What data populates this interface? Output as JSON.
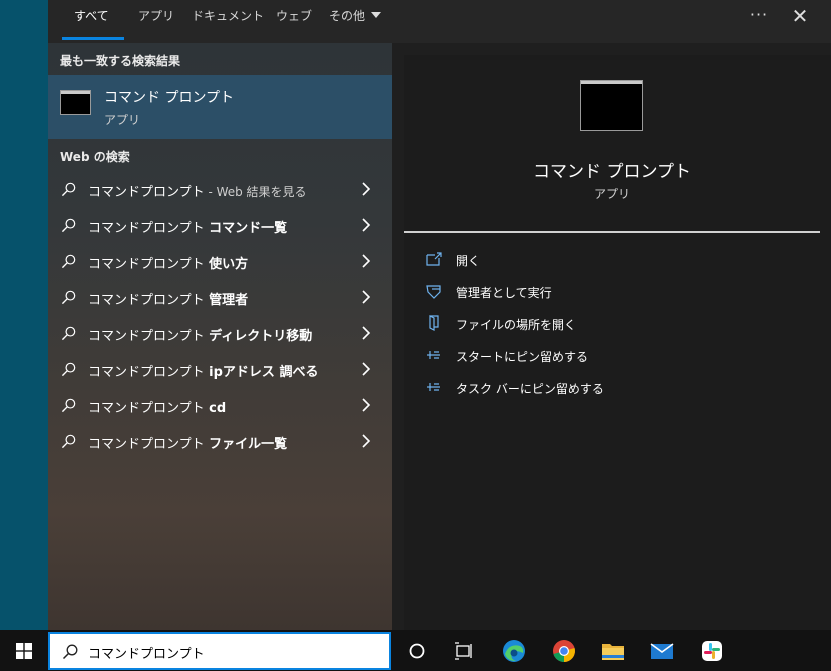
{
  "tabs": [
    {
      "label": "すべて",
      "active": true
    },
    {
      "label": "アプリ"
    },
    {
      "label": "ドキュメント"
    },
    {
      "label": "ウェブ"
    },
    {
      "label": "その他"
    }
  ],
  "window_controls": {
    "more": "···",
    "close": "✕"
  },
  "best_match": {
    "heading": "最も一致する検索結果",
    "title": "コマンド プロンプト",
    "subtitle": "アプリ"
  },
  "web_search": {
    "heading": "Web の検索",
    "items": [
      {
        "base": "コマンドプロンプト",
        "suffix": " - Web 結果を見る",
        "suffix_style": "muted"
      },
      {
        "base": "コマンドプロンプト",
        "suffix": " コマンド一覧",
        "suffix_style": "bold"
      },
      {
        "base": "コマンドプロンプト",
        "suffix": " 使い方",
        "suffix_style": "bold"
      },
      {
        "base": "コマンドプロンプト",
        "suffix": " 管理者",
        "suffix_style": "bold"
      },
      {
        "base": "コマンドプロンプト",
        "suffix": " ディレクトリ移動",
        "suffix_style": "bold"
      },
      {
        "base": "コマンドプロンプト",
        "suffix": " ipアドレス 調べる",
        "suffix_style": "bold"
      },
      {
        "base": "コマンドプロンプト",
        "suffix": " cd",
        "suffix_style": "bold"
      },
      {
        "base": "コマンドプロンプト",
        "suffix": " ファイル一覧",
        "suffix_style": "bold"
      }
    ]
  },
  "preview": {
    "title": "コマンド プロンプト",
    "subtitle": "アプリ",
    "actions": [
      {
        "label": "開く",
        "icon": "open-icon"
      },
      {
        "label": "管理者として実行",
        "icon": "shield-icon"
      },
      {
        "label": "ファイルの場所を開く",
        "icon": "file-location-icon"
      },
      {
        "label": "スタートにピン留めする",
        "icon": "pin-icon"
      },
      {
        "label": "タスク バーにピン留めする",
        "icon": "pin-icon"
      }
    ]
  },
  "taskbar": {
    "search_value": "コマンドプロンプト",
    "icons": [
      "windows-start-icon",
      "cortana-icon",
      "task-view-icon",
      "edge-icon",
      "chrome-icon",
      "file-explorer-icon",
      "mail-icon",
      "slack-icon"
    ]
  },
  "colors": {
    "accent": "#0a84e0",
    "best_match_bg": "#2c4f67",
    "panel_bg": "#1f1f1f",
    "preview_bg": "#1c1c1c",
    "taskbar_bg": "#121212",
    "desktop": "#06526b"
  }
}
